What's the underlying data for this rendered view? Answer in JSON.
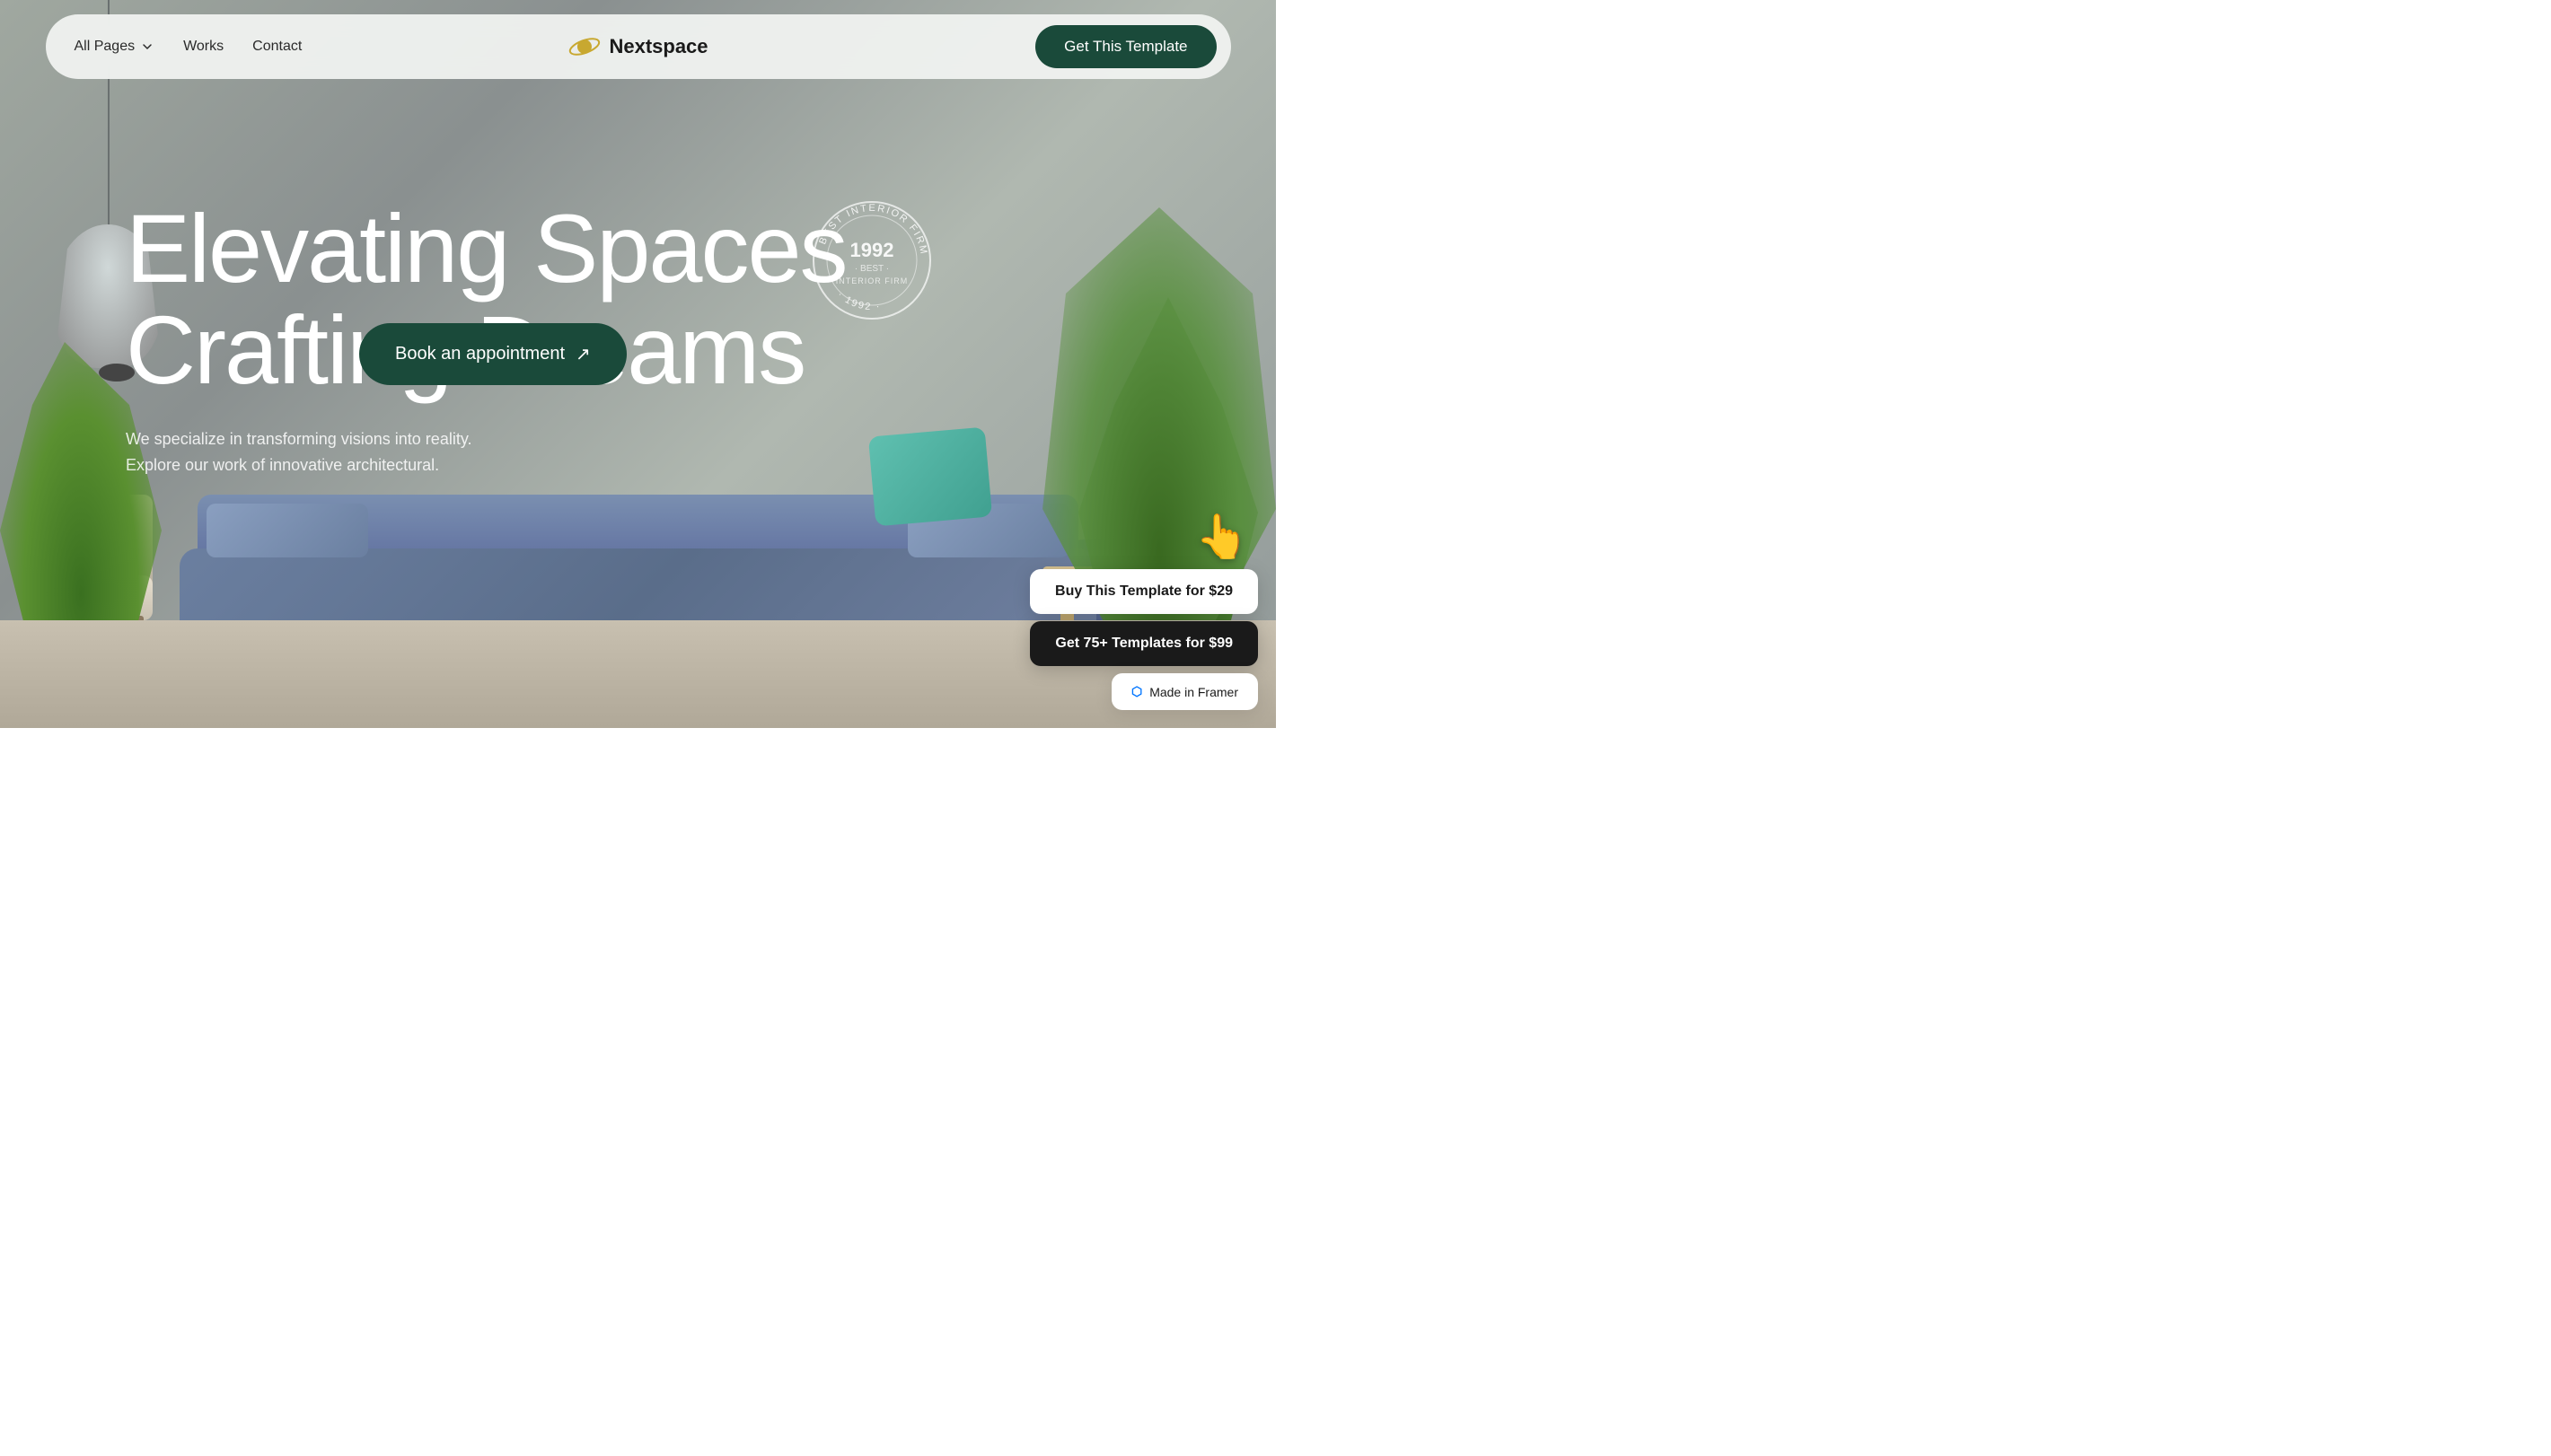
{
  "navbar": {
    "all_pages_label": "All Pages",
    "works_label": "Works",
    "contact_label": "Contact",
    "logo_text": "Nextspace",
    "cta_label": "Get This Template"
  },
  "hero": {
    "title_line1": "Elevating Spaces",
    "title_line2": "Crafting Dreams",
    "subtitle_line1": "We specialize in transforming visions into reality.",
    "subtitle_line2": "Explore our work of innovative architectural.",
    "book_btn_label": "Book an appointment",
    "book_btn_icon": "↗"
  },
  "stamp": {
    "year": "1992",
    "dot": "·",
    "top_text": "BEST INTERIOR",
    "bottom_text": "FIRM"
  },
  "floating_panel": {
    "hand_icon": "👆",
    "buy_btn_label": "Buy This Template for $29",
    "templates_btn_label": "Get 75+ Templates for $99",
    "made_in_label": "Made in Framer"
  },
  "colors": {
    "primary_dark": "#1a4a3a",
    "navbar_bg": "rgba(240, 242, 240, 0.95)",
    "hero_text": "#ffffff",
    "accent_teal": "#5fc0b0"
  }
}
